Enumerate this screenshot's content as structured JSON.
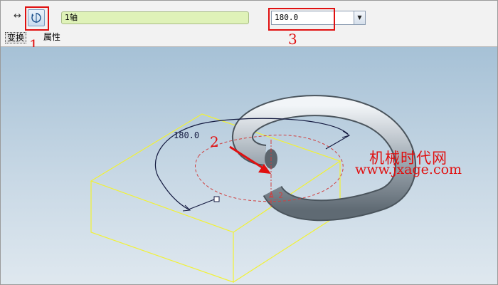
{
  "toolbar": {
    "move_icon": "↔",
    "rotate_icon_name": "rotate-icon",
    "axis_field_value": "1轴",
    "angle_value": "180.0",
    "angle_dropdown_glyph": "▼",
    "tabs": [
      {
        "label": "变换"
      },
      {
        "label": "属性"
      }
    ]
  },
  "callouts": {
    "n1": "1",
    "n2": "2",
    "n3": "3"
  },
  "viewport": {
    "angle_label": "180.0",
    "axis_label": "A_2"
  },
  "watermark": {
    "cn": "机械时代网",
    "url": "www.jxage.com"
  },
  "colors": {
    "bbox": "#f2f233",
    "highlight": "#e01010",
    "axis_field_bg": "#dff2b8"
  }
}
